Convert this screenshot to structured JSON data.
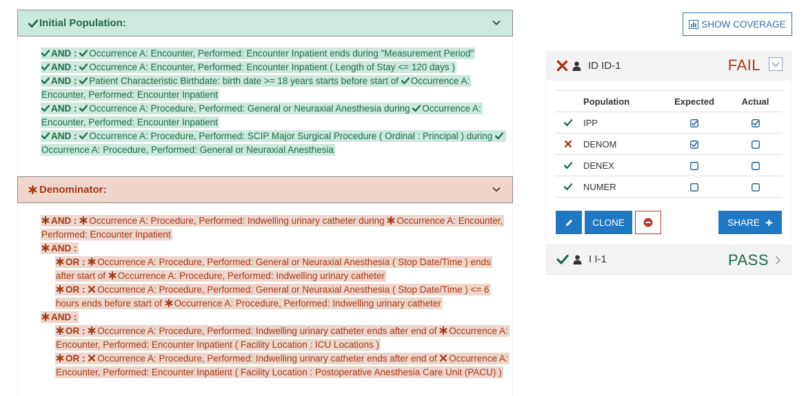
{
  "initial_population": {
    "title": "Initial Population:",
    "lines": [
      {
        "segments": [
          {
            "icon": "check"
          },
          {
            "kw": "AND : "
          },
          {
            "icon": "check"
          },
          {
            "text": "Occurrence A: Encounter, Performed: Encounter Inpatient ends during \"Measurement Period\""
          }
        ]
      },
      {
        "segments": [
          {
            "icon": "check"
          },
          {
            "kw": "AND : "
          },
          {
            "icon": "check"
          },
          {
            "text": "Occurrence A: Encounter, Performed: Encounter Inpatient ( Length of Stay <= 120 days )"
          }
        ]
      },
      {
        "segments": [
          {
            "icon": "check"
          },
          {
            "kw": "AND : "
          },
          {
            "icon": "check"
          },
          {
            "text": "Patient Characteristic Birthdate: birth date >= 18 years starts before start of "
          },
          {
            "icon": "check"
          },
          {
            "text": "Occurrence A: Encounter, Performed: Encounter Inpatient"
          }
        ]
      },
      {
        "segments": [
          {
            "icon": "check"
          },
          {
            "kw": "AND : "
          },
          {
            "icon": "check"
          },
          {
            "text": "Occurrence A: Procedure, Performed: General or Neuraxial Anesthesia during "
          },
          {
            "icon": "check"
          },
          {
            "text": "Occurrence A: Encounter, Performed: Encounter Inpatient"
          }
        ]
      },
      {
        "segments": [
          {
            "icon": "check"
          },
          {
            "kw": "AND : "
          },
          {
            "icon": "check"
          },
          {
            "text": "Occurrence A: Procedure, Performed: SCIP Major Surgical Procedure ( Ordinal : Principal ) during "
          },
          {
            "icon": "check"
          },
          {
            "text": "Occurrence A: Procedure, Performed: General or Neuraxial Anesthesia"
          }
        ]
      }
    ]
  },
  "denominator": {
    "title": "Denominator:",
    "lines": [
      {
        "indent": false,
        "segments": [
          {
            "icon": "asterisk"
          },
          {
            "kw": "AND : "
          },
          {
            "icon": "asterisk"
          },
          {
            "text": "Occurrence A: Procedure, Performed: Indwelling urinary catheter during "
          },
          {
            "icon": "asterisk"
          },
          {
            "text": "Occurrence A: Encounter, Performed: Encounter Inpatient"
          }
        ]
      },
      {
        "indent": false,
        "segments": [
          {
            "icon": "asterisk"
          },
          {
            "kw": "AND :"
          }
        ]
      },
      {
        "indent": true,
        "segments": [
          {
            "icon": "asterisk"
          },
          {
            "kw": "OR : "
          },
          {
            "icon": "asterisk"
          },
          {
            "text": "Occurrence A: Procedure, Performed: General or Neuraxial Anesthesia ( Stop Date/Time ) ends after start of "
          },
          {
            "icon": "asterisk"
          },
          {
            "text": "Occurrence A: Procedure, Performed: Indwelling urinary catheter"
          }
        ]
      },
      {
        "indent": true,
        "segments": [
          {
            "icon": "asterisk"
          },
          {
            "kw": "OR : "
          },
          {
            "icon": "times"
          },
          {
            "text": "Occurrence A: Procedure, Performed: General or Neuraxial Anesthesia ( Stop Date/Time ) <= 6 hours ends before start of "
          },
          {
            "icon": "asterisk"
          },
          {
            "text": "Occurrence A: Procedure, Performed: Indwelling urinary catheter"
          }
        ]
      },
      {
        "indent": false,
        "segments": [
          {
            "icon": "asterisk"
          },
          {
            "kw": "AND :"
          }
        ]
      },
      {
        "indent": true,
        "segments": [
          {
            "icon": "asterisk"
          },
          {
            "kw": "OR : "
          },
          {
            "icon": "asterisk"
          },
          {
            "text": "Occurrence A: Procedure, Performed: Indwelling urinary catheter ends after end of "
          },
          {
            "icon": "asterisk"
          },
          {
            "text": "Occurrence A: Encounter, Performed: Encounter Inpatient ( Facility Location : ICU Locations )"
          }
        ]
      },
      {
        "indent": true,
        "segments": [
          {
            "icon": "asterisk"
          },
          {
            "kw": "OR : "
          },
          {
            "icon": "times"
          },
          {
            "text": "Occurrence A: Procedure, Performed: Indwelling urinary catheter ends after end of "
          },
          {
            "icon": "times"
          },
          {
            "text": "Occurrence A: Encounter, Performed: Encounter Inpatient ( Facility Location : Postoperative Anesthesia Care Unit (PACU) )"
          }
        ]
      }
    ]
  },
  "show_coverage_label": "SHOW COVERAGE",
  "patients": [
    {
      "name": "ID ID-1",
      "verdict": "FAIL",
      "status_icon": "times-icon",
      "table": {
        "headers": [
          "Population",
          "Expected",
          "Actual"
        ],
        "rows": [
          {
            "status": "check",
            "population": "IPP",
            "expected": true,
            "actual": true
          },
          {
            "status": "times",
            "population": "DENOM",
            "expected": true,
            "actual": false
          },
          {
            "status": "check",
            "population": "DENEX",
            "expected": false,
            "actual": false
          },
          {
            "status": "check",
            "population": "NUMER",
            "expected": false,
            "actual": false
          }
        ]
      },
      "buttons": {
        "clone_label": "CLONE",
        "share_label": "SHARE"
      }
    },
    {
      "name": "I I-1",
      "verdict": "PASS",
      "status_icon": "check-icon"
    }
  ],
  "colors": {
    "pass_green": "#1e6b4a",
    "fail_red": "#a33a16",
    "pass_bg": "#cbe9dc",
    "fail_bg": "#efd6cc",
    "primary_blue": "#1f78c1"
  }
}
